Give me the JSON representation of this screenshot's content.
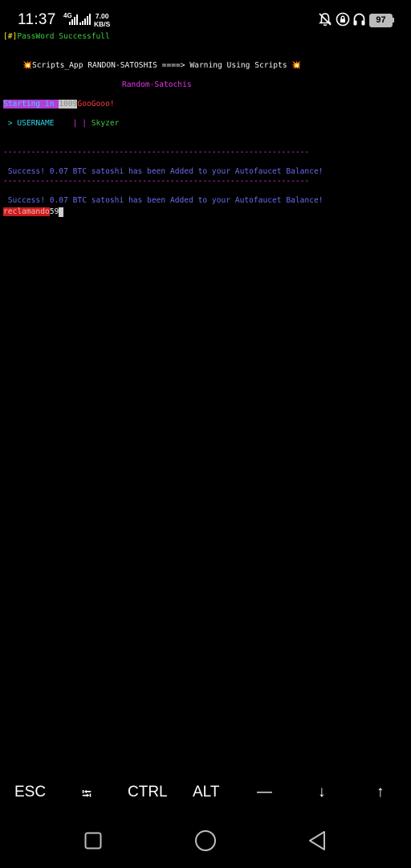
{
  "status_bar": {
    "time": "11:37",
    "network_type": "4G",
    "speed_value": "7.00",
    "speed_unit": "KB/S",
    "battery": "97"
  },
  "terminal": {
    "password_prefix": "[#]",
    "password_text": "PassWord Successfull",
    "banner_left_emoji": "💥",
    "banner_text": "Scripts_App RANDON-SATOSHIS ====> Warning Using Scripts ",
    "banner_right_emoji": "💥",
    "subtitle": "Random-Satochis",
    "starting_label": "Starting in ",
    "starting_count": "1009",
    "starting_suffix": "GooGooo!",
    "username_label": " > USERNAME",
    "username_sep": "| |",
    "username_value": "Skyzer",
    "separator": "------------------------------------------------------------------",
    "success_messages": [
      " Success! 0.07 BTC satoshi has been Added to your Autofaucet Balance!",
      " Success! 0.07 BTC satoshi has been Added to your Autofaucet Balance!"
    ],
    "countdown_label": "reclamando",
    "countdown_value": "59"
  },
  "extra_keys": {
    "esc": "ESC",
    "tab": "⭾",
    "ctrl": "CTRL",
    "alt": "ALT",
    "dash": "—",
    "down": "↓",
    "up": "↑"
  }
}
